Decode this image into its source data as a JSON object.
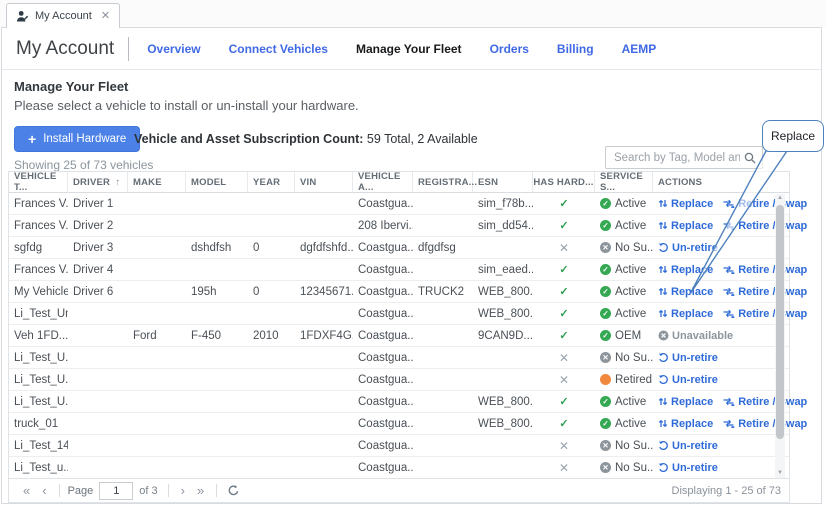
{
  "tab": {
    "title": "My Account"
  },
  "page": {
    "title": "My Account",
    "nav": [
      {
        "label": "Overview",
        "active": false
      },
      {
        "label": "Connect Vehicles",
        "active": false
      },
      {
        "label": "Manage Your Fleet",
        "active": true
      },
      {
        "label": "Orders",
        "active": false
      },
      {
        "label": "Billing",
        "active": false
      },
      {
        "label": "AEMP",
        "active": false
      }
    ]
  },
  "section": {
    "title": "Manage Your Fleet",
    "subtitle": "Please select a vehicle to install or un-install your hardware."
  },
  "toolbar": {
    "install_button": "Install Hardware",
    "subscription_label": "Vehicle and Asset Subscription Count:",
    "subscription_value": "59 Total, 2 Available",
    "showing": "Showing 25 of 73 vehicles",
    "search_placeholder": "Search by Tag, Model and VIN"
  },
  "callout": {
    "label": "Replace"
  },
  "table": {
    "columns": [
      {
        "label": "VEHICLE T...",
        "sort": false
      },
      {
        "label": "DRIVER",
        "sort": true
      },
      {
        "label": "MAKE",
        "sort": false
      },
      {
        "label": "MODEL",
        "sort": false
      },
      {
        "label": "YEAR",
        "sort": false
      },
      {
        "label": "VIN",
        "sort": false
      },
      {
        "label": "VEHICLE A...",
        "sort": false
      },
      {
        "label": "REGISTRA...",
        "sort": false
      },
      {
        "label": "ESN",
        "sort": false
      },
      {
        "label": "HAS HARD...",
        "sort": false
      },
      {
        "label": "SERVICE S...",
        "sort": false
      },
      {
        "label": "ACTIONS",
        "sort": false
      }
    ],
    "rows": [
      {
        "tag": "Frances V...",
        "driver": "Driver 1",
        "make": "",
        "model": "",
        "year": "",
        "vin": "",
        "area": "Coastgua...",
        "registration": "",
        "esn": "sim_f78b...",
        "has_hardware": true,
        "status": {
          "label": "Active",
          "type": "active"
        },
        "actions": [
          {
            "type": "replace",
            "label": "Replace"
          },
          {
            "type": "retire_swap",
            "label": "Retire / Swap"
          }
        ]
      },
      {
        "tag": "Frances V...",
        "driver": "Driver 2",
        "make": "",
        "model": "",
        "year": "",
        "vin": "",
        "area": "208 Ibervi...",
        "registration": "",
        "esn": "sim_dd54...",
        "has_hardware": true,
        "status": {
          "label": "Active",
          "type": "active"
        },
        "actions": [
          {
            "type": "replace",
            "label": "Replace"
          },
          {
            "type": "retire_swap",
            "label": "Retire / Swap"
          }
        ]
      },
      {
        "tag": "sgfdg",
        "driver": "Driver 3",
        "make": "",
        "model": "dshdfsh",
        "year": "0",
        "vin": "dgfdfshfd...",
        "area": "Coastgua...",
        "registration": "dfgdfsg",
        "esn": "",
        "has_hardware": false,
        "status": {
          "label": "No Su...",
          "type": "no_sub"
        },
        "actions": [
          {
            "type": "un_retire",
            "label": "Un-retire"
          }
        ]
      },
      {
        "tag": "Frances V...",
        "driver": "Driver 4",
        "make": "",
        "model": "",
        "year": "",
        "vin": "",
        "area": "Coastgua...",
        "registration": "",
        "esn": "sim_eaed...",
        "has_hardware": true,
        "status": {
          "label": "Active",
          "type": "active"
        },
        "actions": [
          {
            "type": "replace",
            "label": "Replace"
          },
          {
            "type": "retire_swap",
            "label": "Retire / Swap"
          }
        ]
      },
      {
        "tag": "My Vehicle",
        "driver": "Driver 6",
        "make": "",
        "model": "195h",
        "year": "0",
        "vin": "12345671...",
        "area": "Coastgua...",
        "registration": "TRUCK2",
        "esn": "WEB_800...",
        "has_hardware": true,
        "status": {
          "label": "Active",
          "type": "active"
        },
        "actions": [
          {
            "type": "replace",
            "label": "Replace"
          },
          {
            "type": "retire_swap",
            "label": "Retire / Swap"
          }
        ]
      },
      {
        "tag": "Li_Test_Unit",
        "driver": "",
        "make": "",
        "model": "",
        "year": "",
        "vin": "",
        "area": "Coastgua...",
        "registration": "",
        "esn": "WEB_800...",
        "has_hardware": true,
        "status": {
          "label": "Active",
          "type": "active"
        },
        "actions": [
          {
            "type": "replace",
            "label": "Replace"
          },
          {
            "type": "retire_swap",
            "label": "Retire / Swap"
          }
        ]
      },
      {
        "tag": "Veh 1FD...",
        "driver": "",
        "make": "Ford",
        "model": "F-450",
        "year": "2010",
        "vin": "1FDXF4G...",
        "area": "Coastgua...",
        "registration": "",
        "esn": "9CAN9D...",
        "has_hardware": true,
        "status": {
          "label": "OEM",
          "type": "oem"
        },
        "actions": [
          {
            "type": "unavailable",
            "label": "Unavailable"
          }
        ]
      },
      {
        "tag": "Li_Test_U...",
        "driver": "",
        "make": "",
        "model": "",
        "year": "",
        "vin": "",
        "area": "Coastgua...",
        "registration": "",
        "esn": "",
        "has_hardware": false,
        "status": {
          "label": "No Su...",
          "type": "no_sub"
        },
        "actions": [
          {
            "type": "un_retire",
            "label": "Un-retire"
          }
        ]
      },
      {
        "tag": "Li_Test_U...",
        "driver": "",
        "make": "",
        "model": "",
        "year": "",
        "vin": "",
        "area": "Coastgua...",
        "registration": "",
        "esn": "",
        "has_hardware": false,
        "status": {
          "label": "Retired",
          "type": "retired"
        },
        "actions": [
          {
            "type": "un_retire",
            "label": "Un-retire"
          }
        ]
      },
      {
        "tag": "Li_Test_U...",
        "driver": "",
        "make": "",
        "model": "",
        "year": "",
        "vin": "",
        "area": "Coastgua...",
        "registration": "",
        "esn": "WEB_800...",
        "has_hardware": true,
        "status": {
          "label": "Active",
          "type": "active"
        },
        "actions": [
          {
            "type": "replace",
            "label": "Replace"
          },
          {
            "type": "retire_swap",
            "label": "Retire / Swap"
          }
        ]
      },
      {
        "tag": "truck_01",
        "driver": "",
        "make": "",
        "model": "",
        "year": "",
        "vin": "",
        "area": "Coastgua...",
        "registration": "",
        "esn": "WEB_800...",
        "has_hardware": true,
        "status": {
          "label": "Active",
          "type": "active"
        },
        "actions": [
          {
            "type": "replace",
            "label": "Replace"
          },
          {
            "type": "retire_swap",
            "label": "Retire / Swap"
          }
        ]
      },
      {
        "tag": "Li_Test_14",
        "driver": "",
        "make": "",
        "model": "",
        "year": "",
        "vin": "",
        "area": "Coastgua...",
        "registration": "",
        "esn": "",
        "has_hardware": false,
        "status": {
          "label": "No Su...",
          "type": "no_sub"
        },
        "actions": [
          {
            "type": "un_retire",
            "label": "Un-retire"
          }
        ]
      },
      {
        "tag": "Li_Test_u...",
        "driver": "",
        "make": "",
        "model": "",
        "year": "",
        "vin": "",
        "area": "Coastgua...",
        "registration": "",
        "esn": "",
        "has_hardware": false,
        "status": {
          "label": "No Su...",
          "type": "no_sub"
        },
        "actions": [
          {
            "type": "un_retire",
            "label": "Un-retire"
          }
        ]
      }
    ]
  },
  "pagination": {
    "first": "«",
    "prev": "‹",
    "page_label": "Page",
    "page_value": "1",
    "of_label": "of 3",
    "next": "›",
    "last": "»",
    "displaying": "Displaying 1 - 25 of 73"
  },
  "colors": {
    "accent_blue": "#2f6bd8",
    "button_blue": "#4c82e8",
    "status_green": "#34a853",
    "status_gray": "#8d959c",
    "status_orange": "#f0883e",
    "callout_border": "#4f81bd"
  }
}
